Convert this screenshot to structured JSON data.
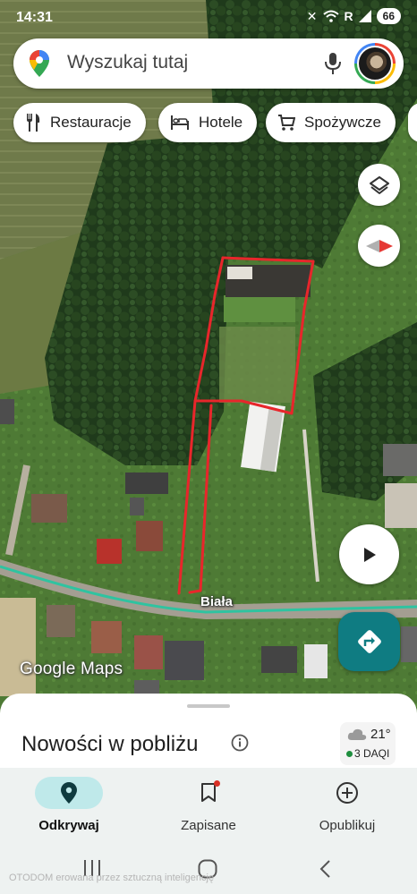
{
  "status_bar": {
    "time": "14:31",
    "battery": "66",
    "signal_label": "R"
  },
  "search": {
    "placeholder": "Wyszukaj tutaj",
    "icons": [
      "google-maps-pin-icon",
      "microphone-icon",
      "account-avatar"
    ]
  },
  "chips": [
    {
      "label": "Restauracje",
      "icon": "fork-knife-icon"
    },
    {
      "label": "Hotele",
      "icon": "bed-icon"
    },
    {
      "label": "Spożywcze",
      "icon": "shopping-cart-icon"
    }
  ],
  "map": {
    "street_label": "Biała",
    "logo": "Google Maps",
    "colors": {
      "annotation": "#e8262b",
      "road_highlight": "#2fc3a0",
      "accent": "#0f7c82"
    }
  },
  "buttons": {
    "layers_icon": "layers-icon",
    "compass_icon": "compass-icon",
    "play_icon": "play-icon",
    "directions_icon": "directions-icon"
  },
  "sheet": {
    "title": "Nowości w pobliżu",
    "weather": {
      "temperature": "21°",
      "aqi": "3 DAQI"
    }
  },
  "nav": {
    "items": [
      {
        "label": "Odkrywaj",
        "icon": "location-pin-icon",
        "active": true
      },
      {
        "label": "Zapisane",
        "icon": "bookmark-icon",
        "active": false
      },
      {
        "label": "Opublikuj",
        "icon": "add-circle-icon",
        "active": false
      }
    ]
  },
  "watermark": "OTODOM erowana przez sztuczną inteligencję"
}
